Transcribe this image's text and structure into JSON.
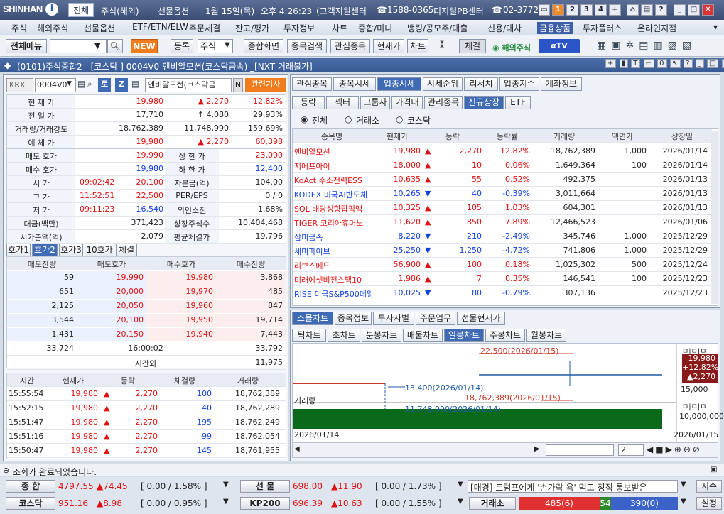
{
  "title": {
    "brand": "SHINHAN",
    "tab1": "전체",
    "tab2": "주식(해외)",
    "tab3": "선물옵션",
    "date": "1월 15일(목)",
    "time": "오후 4:26:23",
    "center": "(고객지원센터",
    "phone1": "1588-0365,",
    "pb": "디지털PB센터",
    "phone2": "02-3772-",
    "nums": [
      "1",
      "2",
      "3",
      "4",
      "+"
    ]
  },
  "menu": [
    "주식",
    "해외주식",
    "선물옵션",
    "ETF/ETN/ELW",
    "주문체결",
    "잔고/평가",
    "투자정보",
    "차트",
    "종합/미니",
    "뱅킹/공모주/대출",
    "신용/대차",
    "금융상품",
    "투자플러스",
    "온라인지점"
  ],
  "toolbar": {
    "menu_btn": "전체메뉴",
    "new_badge": "NEW",
    "reg": "등록",
    "stock": "주식",
    "buttons": [
      "종합화면",
      "종목검색",
      "관심종목",
      "현재가",
      "차트"
    ],
    "lock": "체결",
    "overseas": "해외주식",
    "tv": "αTV"
  },
  "window": {
    "title": "(0101)주식종합2 - [코스닥 ] 0004V0-엔비알모션(코스닥금속) _[NXT 거래불가]"
  },
  "stock": {
    "market": "KRX",
    "code": "0004V0",
    "name": "엔비알모션(코스닥금",
    "n": "N",
    "news": "관련기사"
  },
  "quote": [
    {
      "l": "현 재 가",
      "v1": "19,980",
      "v2": "▲ 2,270",
      "v3": "12.82%",
      "c": "red"
    },
    {
      "l": "전 일 가",
      "v1": "17,710",
      "v2": "↑ 4,080",
      "v3": "29.93%",
      "c": "k"
    },
    {
      "l": "거래량/거래강도",
      "v1": "18,762,389",
      "v2": "11,748,990",
      "v3": "159.69%",
      "c": "k"
    },
    {
      "l": "예 체 가",
      "v1": "19,980",
      "v2": "▲ 2,270",
      "v3": "60,398",
      "c": "red"
    }
  ],
  "quote2": [
    {
      "l": "매도 호가",
      "v": "19,990",
      "l2": "상 한 가",
      "v2": "23,000"
    },
    {
      "l": "매수 호가",
      "v": "19,980",
      "l2": "하 한 가",
      "v2": "12,400"
    },
    {
      "l": "시 가",
      "t": "09:02:42",
      "v": "20,100",
      "l2": "자본금(억)",
      "v2": "104.00"
    },
    {
      "l": "고 가",
      "t": "11:52:51",
      "v": "22,500",
      "l2": "PER/EPS",
      "v2": "0 / 0"
    },
    {
      "l": "저 가",
      "t": "09:11:23",
      "v": "16,540",
      "l2": "외인소진",
      "v2": "1.68%"
    },
    {
      "l": "대금(백만)",
      "v": "371,423",
      "l2": "상장주식수",
      "v2": "10,404,468"
    },
    {
      "l": "시가총액(억)",
      "v": "2,079",
      "l2": "평균체결가",
      "v2": "19,796"
    }
  ],
  "ob_tabs": [
    "호가1",
    "호가2",
    "호가3",
    "10호가",
    "체결"
  ],
  "ob_head": [
    "매도잔량",
    "매도호가",
    "매수호가",
    "매수잔량"
  ],
  "ob_rows": [
    [
      "59",
      "19,990",
      "19,980",
      "3,868"
    ],
    [
      "651",
      "20,000",
      "19,970",
      "485"
    ],
    [
      "2,125",
      "20,050",
      "19,960",
      "847"
    ],
    [
      "3,544",
      "20,100",
      "19,950",
      "19,714"
    ],
    [
      "1,431",
      "20,150",
      "19,940",
      "7,443"
    ]
  ],
  "ob_sum": {
    "ask": "33,724",
    "time": "16:00:02",
    "bid": "33,792"
  },
  "ob_after": {
    "label": "시간외",
    "bid": "11,975"
  },
  "tr_head": [
    "시간",
    "현재가",
    "등락",
    "체결량",
    "거래량"
  ],
  "tr_rows": [
    [
      "15:55:54",
      "19,980",
      "▲",
      "2,270",
      "100",
      "18,762,389"
    ],
    [
      "15:52:15",
      "19,980",
      "▲",
      "2,270",
      "40",
      "18,762,289"
    ],
    [
      "15:51:47",
      "19,980",
      "▲",
      "2,270",
      "195",
      "18,762,249"
    ],
    [
      "15:51:16",
      "19,980",
      "▲",
      "2,270",
      "99",
      "18,762,054"
    ],
    [
      "15:50:47",
      "19,980",
      "▲",
      "2,270",
      "145",
      "18,761,955"
    ]
  ],
  "rt_tabs": [
    "관심종목",
    "종목시세",
    "업종시세",
    "시세순위",
    "리서치",
    "업종지수",
    "계좌정보"
  ],
  "rt_sub": [
    "등락",
    "섹터",
    "그룹사",
    "가격대",
    "관리종목",
    "신규상장",
    "ETF"
  ],
  "radio": [
    "전체",
    "거래소",
    "코스닥"
  ],
  "lst_head": [
    "종목명",
    "현재가",
    "등락",
    "등락률",
    "거래량",
    "액면가",
    "상장일"
  ],
  "lst": [
    [
      "엔비알모션",
      "19,980",
      "▲",
      "2,270",
      "12.82%",
      "18,762,389",
      "1,000",
      "2026/01/14",
      "r"
    ],
    [
      "지에프아이",
      "18,000",
      "▲",
      "10",
      "0.06%",
      "1,649,364",
      "100",
      "2026/01/14",
      "r"
    ],
    [
      "KoAct 수소전력ESS",
      "10,635",
      "▲",
      "55",
      "0.52%",
      "492,375",
      "",
      "2026/01/13",
      "r"
    ],
    [
      "KODEX 미국AI반도체",
      "10,265",
      "▼",
      "40",
      "-0.39%",
      "3,011,664",
      "",
      "2026/01/13",
      "b"
    ],
    [
      "SOL 배당성향탑픽액",
      "10,325",
      "▲",
      "105",
      "1.03%",
      "604,301",
      "",
      "2026/01/13",
      "r"
    ],
    [
      "TIGER 코리아휴머노",
      "11,620",
      "▲",
      "850",
      "7.89%",
      "12,466,523",
      "",
      "2026/01/06",
      "r"
    ],
    [
      "삼미금속",
      "8,220",
      "▼",
      "210",
      "-2.49%",
      "345,746",
      "1,000",
      "2025/12/29",
      "b"
    ],
    [
      "세미파이브",
      "25,250",
      "▼",
      "1,250",
      "-4.72%",
      "741,806",
      "1,000",
      "2025/12/29",
      "b"
    ],
    [
      "리브스메드",
      "56,900",
      "▲",
      "100",
      "0.18%",
      "1,025,302",
      "500",
      "2025/12/24",
      "r"
    ],
    [
      "미래에셋비전스팩10",
      "1,986",
      "▲",
      "7",
      "0.35%",
      "146,541",
      "100",
      "2025/12/23",
      "r"
    ],
    [
      "RISE 미국S&P500데일",
      "10,025",
      "▼",
      "80",
      "-0.79%",
      "307,136",
      "",
      "2025/12/23",
      "b"
    ]
  ],
  "ch_tabs": [
    "스몰차트",
    "종목정보",
    "투자자별",
    "주문업무",
    "선물현재가"
  ],
  "ch_sub": [
    "틱차트",
    "초차트",
    "분봉차트",
    "매물차트",
    "일봉차트",
    "주봉차트",
    "월봉차트"
  ],
  "chart": {
    "hi": "22,500(2026/01/15)",
    "lo": "13,400(2026/01/14)",
    "vol_label": "거래량",
    "vol_hi": "18,762,389(2026/01/15)",
    "vol_lo": "11,748,990(2026/01/14)",
    "px": "19,980",
    "pct": "+12.82%",
    "chg": "▲2,270",
    "tick1": "15,000",
    "tick2": "10,000,000",
    "d1": "2026/01/14",
    "d2": "2026/01/15",
    "zoom": "2"
  },
  "status": "조회가 완료되었습니다.",
  "ticker1": [
    {
      "k": "종 합",
      "v": "4797.55",
      "c": "▲74.45",
      "b": "[ 0.00 / 1.58% ]"
    },
    {
      "k": "선 물",
      "v": "698.00",
      "c": "▲11.90",
      "b": "[ 0.00 / 1.73% ]"
    }
  ],
  "ticker2": [
    {
      "k": "코스닥",
      "v": "951.16",
      "c": "▲8.98",
      "b": "[ 0.00 / 0.95% ]"
    },
    {
      "k": "KP200",
      "v": "696.39",
      "c": "▲10.63",
      "b": "[ 0.00 / 1.55% ]"
    }
  ],
  "news": "[매경] 트럼프에게 '손가락 욕' 먹고 정직 통보받은",
  "exch": {
    "k": "거래소",
    "up": "485(6)",
    "mid": "54",
    "dn": "390(0)"
  },
  "btn_index": "지수",
  "btn_setting": "설정"
}
